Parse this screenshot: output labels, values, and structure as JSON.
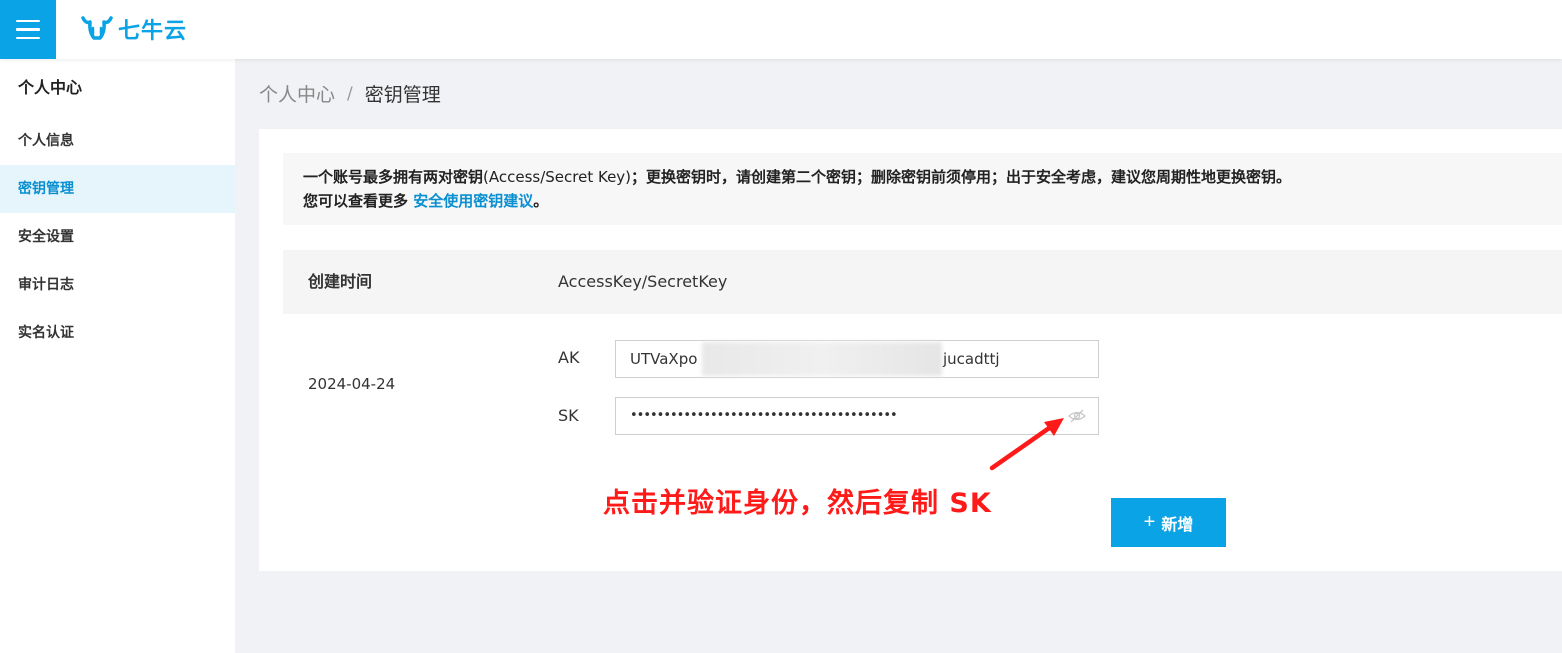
{
  "header": {
    "logo_text": "七牛云"
  },
  "sidebar": {
    "title": "个人中心",
    "items": [
      {
        "label": "个人信息"
      },
      {
        "label": "密钥管理",
        "active": true
      },
      {
        "label": "安全设置"
      },
      {
        "label": "审计日志"
      },
      {
        "label": "实名认证"
      }
    ]
  },
  "breadcrumb": {
    "parent": "个人中心",
    "separator": "/",
    "current": "密钥管理"
  },
  "notice": {
    "line1_a": "一个账号最多拥有两对密钥",
    "line1_b": "(Access/Secret Key)",
    "line1_c": "；更换密钥时，请创建第二个密钥；删除密钥前须停用；出于安全考虑，建议您周期性地更换密钥。",
    "line2_a": "您可以查看更多 ",
    "line2_link": "安全使用密钥建议",
    "line2_b": "。"
  },
  "table": {
    "col_created": "创建时间",
    "col_keys": "AccessKey/SecretKey",
    "rows": [
      {
        "date": "2024-04-24",
        "ak_label": "AK",
        "ak_prefix": "UTVaXpo",
        "ak_suffix": "jucadttj",
        "sk_label": "SK",
        "sk_masked": "••••••••••••••••••••••••••••••••••••••••"
      }
    ]
  },
  "annotation": "点击并验证身份，然后复制 SK",
  "add_button": {
    "icon": "+",
    "label": "新增"
  },
  "colors": {
    "primary": "#0aa3e6",
    "annotation": "#ff1a1a"
  }
}
